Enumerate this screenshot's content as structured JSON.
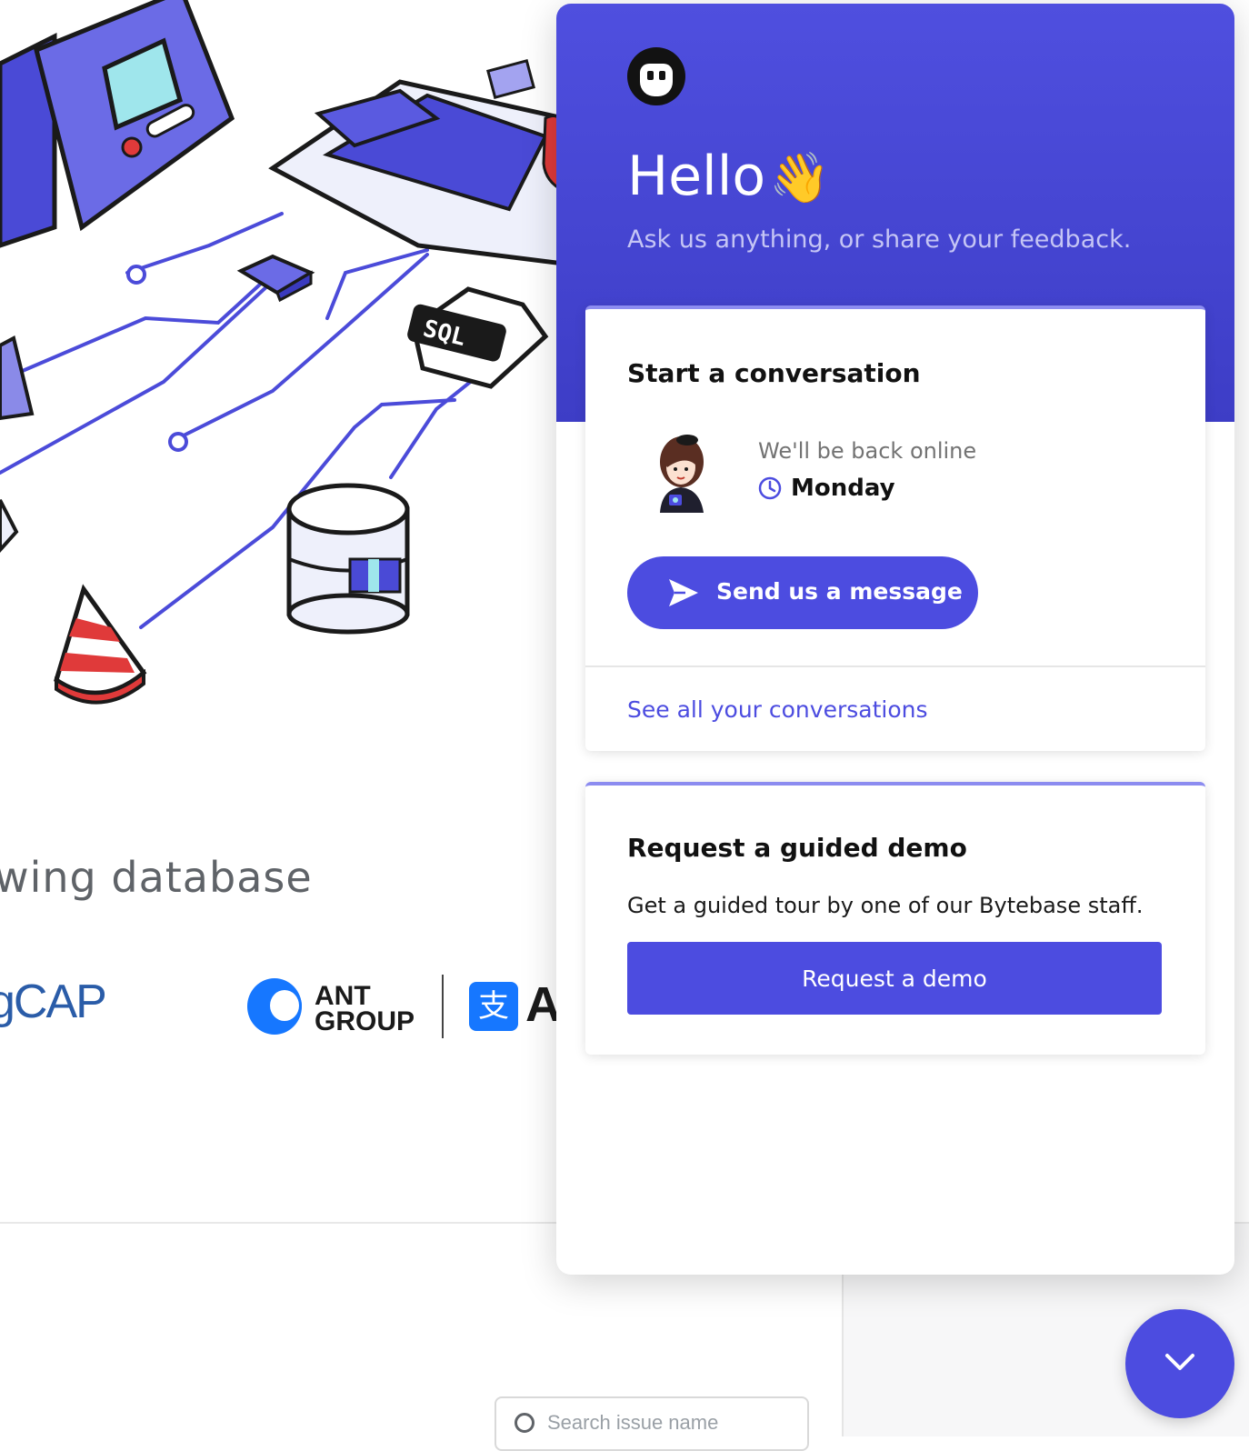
{
  "background": {
    "headline": "wing database",
    "partner_logos": {
      "logo_left_text": "gCAP",
      "ant_group_line1": "ANT",
      "ant_group_line2": "GROUP",
      "alipay_glyph": "支",
      "alipay_letter": "A"
    },
    "illustration_badge": "SQL",
    "search": {
      "placeholder": "Search issue name"
    }
  },
  "messenger": {
    "greeting": "Hello",
    "greeting_emoji": "👋",
    "subtitle": "Ask us anything, or share your feedback.",
    "conversation_card": {
      "title": "Start a conversation",
      "status_text": "We'll be back online",
      "status_day": "Monday",
      "send_button_label": "Send us a message",
      "see_all_link": "See all your conversations"
    },
    "demo_card": {
      "title": "Request a guided demo",
      "description": "Get a guided tour by one of our Bytebase staff.",
      "button_label": "Request a demo"
    }
  },
  "icons": {
    "logo": "bytebase-logo-icon",
    "clock": "clock-icon",
    "send": "send-icon",
    "launcher": "chevron-down-icon"
  },
  "colors": {
    "brand": "#4c4ce0",
    "header_top": "#4f4fdf",
    "header_bottom": "#3d3dc6",
    "subtitle": "#c5c5f5",
    "card_accent": "#8c8cf0"
  }
}
